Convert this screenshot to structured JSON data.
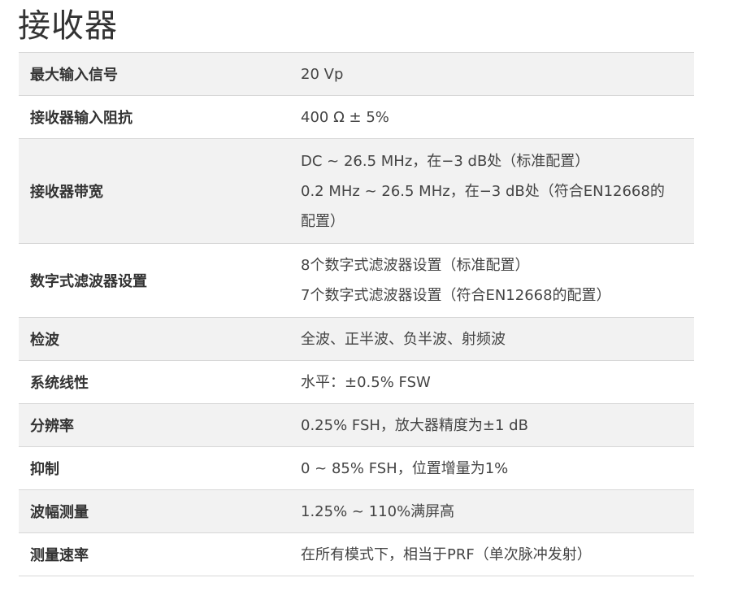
{
  "section": {
    "title": "接收器"
  },
  "rows": [
    {
      "label": "最大输入信号",
      "values": [
        "20 Vp"
      ]
    },
    {
      "label": "接收器输入阻抗",
      "values": [
        "400 Ω ± 5%"
      ]
    },
    {
      "label": "接收器带宽",
      "values": [
        "DC ~ 26.5 MHz，在−3 dB处（标准配置）",
        "0.2 MHz ~ 26.5 MHz，在−3 dB处（符合EN12668的",
        "配置）"
      ]
    },
    {
      "label": "数字式滤波器设置",
      "values": [
        "8个数字式滤波器设置（标准配置）",
        "7个数字式滤波器设置（符合EN12668的配置）"
      ]
    },
    {
      "label": "检波",
      "values": [
        "全波、正半波、负半波、射频波"
      ]
    },
    {
      "label": "系统线性",
      "values": [
        "水平：±0.5% FSW"
      ]
    },
    {
      "label": "分辨率",
      "values": [
        "0.25% FSH，放大器精度为±1 dB"
      ]
    },
    {
      "label": "抑制",
      "values": [
        "0 ~ 85% FSH，位置增量为1%"
      ]
    },
    {
      "label": "波幅测量",
      "values": [
        "1.25% ~ 110%满屏高"
      ]
    },
    {
      "label": "测量速率",
      "values": [
        "在所有模式下，相当于PRF（单次脉冲发射）"
      ]
    }
  ]
}
